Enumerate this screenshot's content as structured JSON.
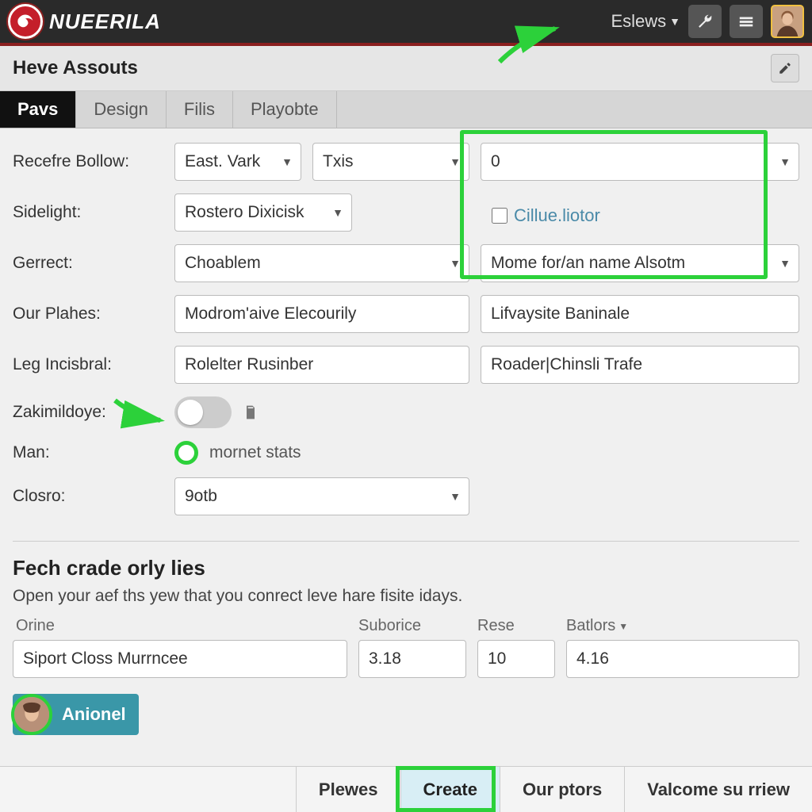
{
  "brand": "NUEERILA",
  "top_menu_label": "Eslews",
  "page_title": "Heve Assouts",
  "tabs": [
    "Pavs",
    "Design",
    "Filis",
    "Playobte"
  ],
  "form": {
    "row1": {
      "label": "Recefre Bollow:",
      "sel1": "East. Vark",
      "sel2": "Txis",
      "sel3": "0"
    },
    "row2": {
      "label": "Sidelight:",
      "sel1": "Rostero Dixicisk",
      "checkbox_label": "Cillue.liotor"
    },
    "row3": {
      "label": "Gerrect:",
      "sel1": "Choablem",
      "sel2": "Mome for/an name Alsotm"
    },
    "row4": {
      "label": "Our Plahes:",
      "in1": "Modrom'aive Elecourily",
      "in2": "Lifvaysite Baninale"
    },
    "row5": {
      "label": "Leg Incisbral:",
      "in1": "Rolelter Rusinber",
      "in2": "Roader|Chinsli Trafe"
    },
    "row6": {
      "label": "Zakimildoye:"
    },
    "row7": {
      "label": "Man:",
      "radio_label": "mornet stats"
    },
    "row8": {
      "label": "Closro:",
      "sel1": "9otb"
    }
  },
  "section2": {
    "title": "Fech crade orly lies",
    "desc": "Open your aef ths yew that you conrect leve hare fisite idays.",
    "headers": {
      "c1": "Orine",
      "c2": "Suborice",
      "c3": "Rese",
      "c4": "Batlors"
    },
    "row": {
      "c1": "Siport Closs Murrncee",
      "c2": "3.18",
      "c3": "10",
      "c4": "4.16"
    }
  },
  "userpill_name": "Anionel",
  "footer": {
    "b1": "Plewes",
    "b2": "Create",
    "b3": "Our ptors",
    "b4": "Valcome su rriew"
  }
}
